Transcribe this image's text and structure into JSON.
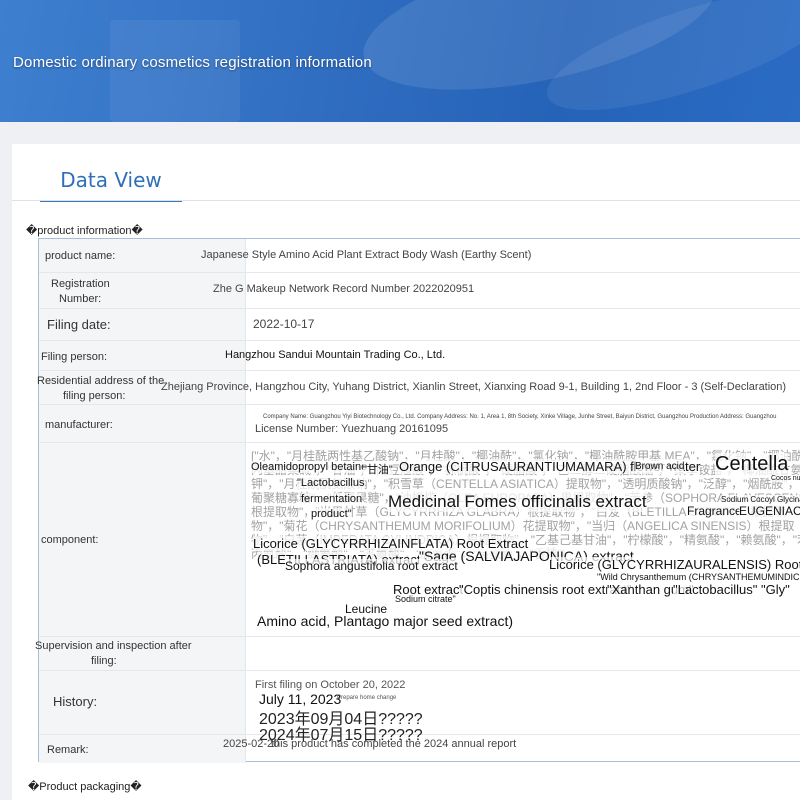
{
  "header": {
    "title": "Domestic ordinary cosmetics registration information"
  },
  "tabs": [
    {
      "label": "Data View"
    }
  ],
  "sections": {
    "product_information": "�product information�",
    "product_packaging": "�Product packaging�"
  },
  "fields": {
    "product_name": {
      "label": "product name:",
      "value": "Japanese Style Amino Acid Plant Extract Body Wash (Earthy Scent)"
    },
    "registration_number": {
      "label_1": "Registration",
      "label_2": "Number:",
      "value": "Zhe G Makeup Network Record Number 2022020951"
    },
    "filing_date": {
      "label": "Filing date:",
      "value": "2022-10-17"
    },
    "filing_person": {
      "label": "Filing person:",
      "value": "Hangzhou Sandui Mountain Trading Co., Ltd."
    },
    "residential_address": {
      "label_1": "Residential address of the",
      "label_2": "filing person:",
      "value": "Zhejiang Province, Hangzhou City, Yuhang District, Xianlin Street, Xianxing Road 9-1, Building 1, 2nd Floor - 3 (Self-Declaration)"
    },
    "manufacturer": {
      "label": "manufacturer:",
      "address": "Company Name: Guangzhou Yiyi Biotechnology Co., Ltd. Company Address: No. 1, Area 1, 8th Society, Xinke Village, Junhe Street, Baiyun District, Guangzhou Production Address: Guangzhou",
      "license": "License Number: Yuezhuang 20161095"
    },
    "component": {
      "label": "component:",
      "background_text": "[\"水\"，\"月桂酰两性基乙酸钠\"，\"月桂酸\"，\"椰油酰\"，\"氯化钠\"，\"椰油酰胺甲基 MEA\"，\"氯化钠\"，\"椰油酰胺丙基甜菜碱\"，\"甘油\"，\"肉豆蔻酸\"，\"棕榈酸\"，\"硬脂酸\"，\"乙二醇二硬脂酸酯\"，\"聚季铵盐\"，\"椰油酰甘氨酸钾\"，\"月桂酰肌氨酸钠\"，\"积雪草（CENTELLA ASIATICA）提取物\"，\"透明质酸钠\"，\"泛醇\"，\"烟酰胺\"，\"α-葡聚糖寡糖\"，\"低聚果糖\"，\"油橄榄（OLEA EUROPAEA）果提取物\"，\"苦参（SOPHORA FLAVESCENS）根提取物\"，\"光果甘草（GLYCYRRHIZA GLABRA）根提取物\"，\"白芨（BLETILLA STRIATA）根提取物\"，\"菊花（CHRYSANTHEMUM MORIFOLIUM）花提取物\"，\"当归（ANGELICA SINENSIS）根提取物\"，\"白茅（IMPERATA CYLINDRICA）根提取物\"，\"乙基己基甘油\"，\"柠檬酸\"，\"精氨酸\"，\"赖氨酸\"，\"苯丙氨酸\"，\"缬氨酸\"，\"苏氨酸\"，\"脯氨酸\"，\"亮氨酸\"，\"香精\"]",
      "fragments": [
        {
          "t": "Oleamidopropyl betaine",
          "s": 11
        },
        {
          "t": "\"甘油\"",
          "s": 11
        },
        {
          "t": "Orange (CITRUSAURANTIUMAMARA) flower water",
          "s": 13
        },
        {
          "t": "Brown acid",
          "s": 10
        },
        {
          "t": "Centella",
          "s": 20
        },
        {
          "t": "\"Lactobacillus",
          "s": 11
        },
        {
          "t": "fermentation",
          "s": 11
        },
        {
          "t": "Cocos nucifera",
          "s": 7
        },
        {
          "t": "Medicinal Fomes officinalis extract",
          "s": 17
        },
        {
          "t": "Sodium Cocoyl Glycinate",
          "s": 8
        },
        {
          "t": "product\"",
          "s": 11
        },
        {
          "t": "Fragrance",
          "s": 12
        },
        {
          "t": "EUGENIACARYOPHYLLUS",
          "s": 12
        },
        {
          "t": "Licorice (GLYCYRRHIZAINFLATA) Root Extract",
          "s": 13
        },
        {
          "t": "(BLETILLASTRIATA) extract",
          "s": 13
        },
        {
          "t": "\"Sage (SALVIAJAPONICA) extract",
          "s": 14
        },
        {
          "t": "Sophora angustifolia root extract",
          "s": 12
        },
        {
          "t": "Licorice (GLYCYRRHIZAURALENSIS) Root Extract",
          "s": 13
        },
        {
          "t": "\"Wild Chrysanthemum (CHRYSANTHEMUMINDICUM)\"",
          "s": 9
        },
        {
          "t": "Root extract",
          "s": 13
        },
        {
          "t": "\"Coptis chinensis root extract\"",
          "s": 13
        },
        {
          "t": "\"Xanthan gum\"",
          "s": 13
        },
        {
          "t": "\"Lactobacillus\"",
          "s": 13
        },
        {
          "t": "\"Gly\"",
          "s": 13
        },
        {
          "t": "Leucine",
          "s": 12
        },
        {
          "t": "Sodium citrate\"",
          "s": 9
        },
        {
          "t": "Amino acid, Plantago major seed extract)",
          "s": 14
        }
      ]
    },
    "supervision": {
      "label_1": "Supervision and inspection after",
      "label_2": "filing:",
      "value": ""
    },
    "history": {
      "label": "History:",
      "lines": [
        {
          "t": "First filing on October 20, 2022",
          "s": 11
        },
        {
          "t": "July 11, 2023",
          "s": 14
        },
        {
          "t": "Prepare home change",
          "s": 6
        },
        {
          "t": "2023年09月04日?????",
          "s": 16
        },
        {
          "t": "2024年07月15日?????",
          "s": 16
        }
      ]
    },
    "remark": {
      "label": "Remark:",
      "date": "2025-02-20",
      "note": "this product has completed the 2024 annual report"
    }
  },
  "colors": {
    "banner": "#2f6cc0",
    "tab_text": "#2f6fb8",
    "table_border": "#a8bedb",
    "label_bg": "#f4f5f7"
  }
}
